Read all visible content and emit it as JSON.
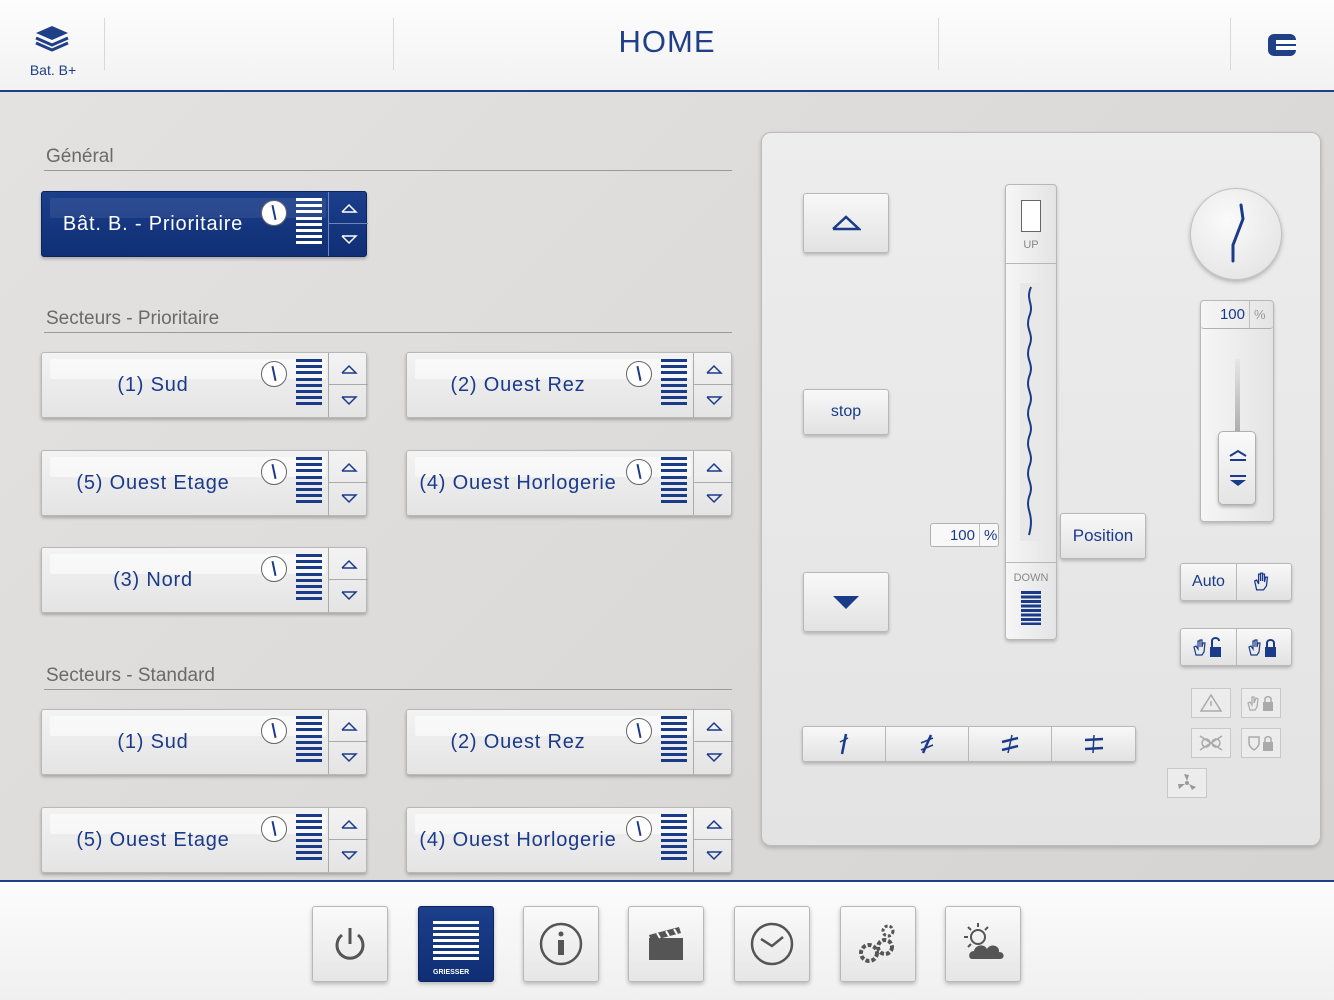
{
  "header": {
    "building_label": "Bat. B+",
    "title": "HOME"
  },
  "sections": {
    "general": {
      "title": "Général",
      "groups": [
        {
          "label": "Bât. B. - Prioritaire",
          "selected": true
        }
      ]
    },
    "prioritaire": {
      "title": "Secteurs - Prioritaire",
      "groups": [
        {
          "label": "(1) Sud"
        },
        {
          "label": "(2) Ouest Rez"
        },
        {
          "label": "(5) Ouest Etage"
        },
        {
          "label": "(4) Ouest Horlogerie"
        },
        {
          "label": "(3) Nord"
        }
      ]
    },
    "standard": {
      "title": "Secteurs - Standard",
      "groups": [
        {
          "label": "(1) Sud"
        },
        {
          "label": "(2) Ouest Rez"
        },
        {
          "label": "(5) Ouest Etage"
        },
        {
          "label": "(4) Ouest Horlogerie"
        }
      ]
    }
  },
  "control_panel": {
    "stop_label": "stop",
    "up_label": "UP",
    "down_label": "DOWN",
    "position_label": "Position",
    "position_value": "100",
    "position_unit": "%",
    "slat_value": "100",
    "slat_unit": "%",
    "auto_label": "Auto",
    "icons": {
      "up": "up-arrow-icon",
      "down": "down-arrow-icon",
      "manual": "hand-icon",
      "manual_unlock": "hand-unlock-icon",
      "manual_lock": "hand-lock-icon",
      "warning": "warning-icon",
      "wind": "wind-icon"
    }
  },
  "footer": {
    "items": [
      {
        "name": "power",
        "icon": "power-icon"
      },
      {
        "name": "blinds",
        "icon": "blinds-icon",
        "active": true,
        "brand": "GRIESSER"
      },
      {
        "name": "info",
        "icon": "info-icon"
      },
      {
        "name": "scenes",
        "icon": "clapper-icon"
      },
      {
        "name": "timer",
        "icon": "clock-icon"
      },
      {
        "name": "settings",
        "icon": "gears-icon"
      },
      {
        "name": "weather",
        "icon": "weather-icon"
      }
    ]
  },
  "colors": {
    "accent": "#1f3f86",
    "selected_bg": "#163786",
    "text_blue": "#1a3a8a"
  }
}
